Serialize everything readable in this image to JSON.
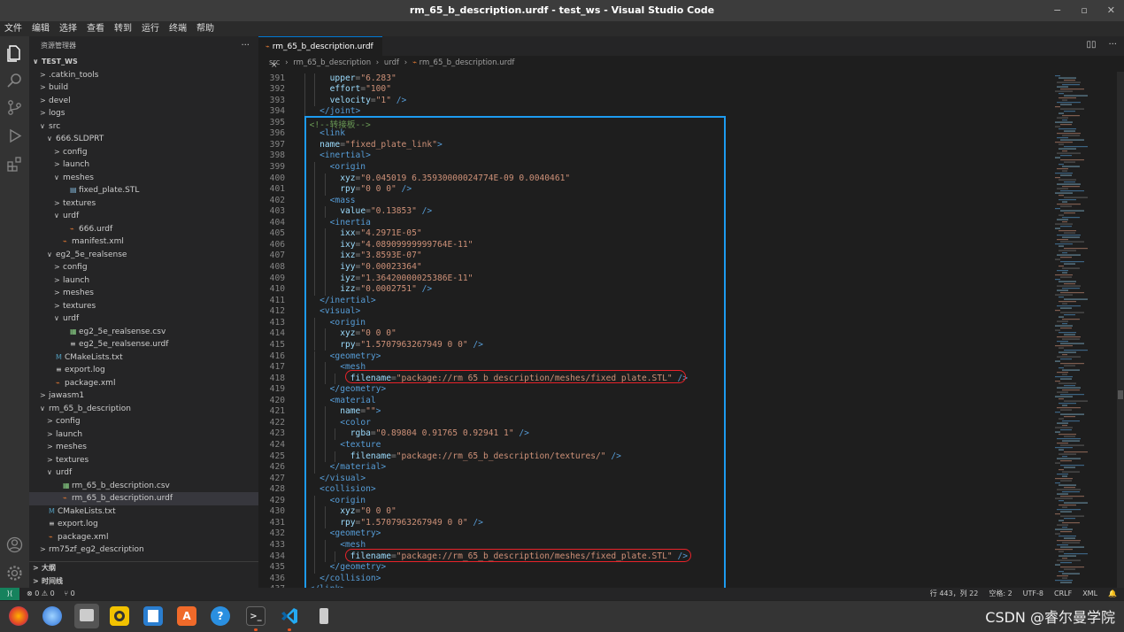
{
  "window": {
    "title": "rm_65_b_description.urdf - test_ws - Visual Studio Code"
  },
  "menu": [
    "文件",
    "编辑",
    "选择",
    "查看",
    "转到",
    "运行",
    "终端",
    "帮助"
  ],
  "sidebar": {
    "header": "资源管理器",
    "more": "···",
    "rows": [
      {
        "label": "TEST_WS",
        "depth": 0,
        "chev": "∨",
        "icon": "",
        "bold": true
      },
      {
        "label": ".catkin_tools",
        "depth": 1,
        "chev": ">",
        "icon": ""
      },
      {
        "label": "build",
        "depth": 1,
        "chev": ">",
        "icon": ""
      },
      {
        "label": "devel",
        "depth": 1,
        "chev": ">",
        "icon": ""
      },
      {
        "label": "logs",
        "depth": 1,
        "chev": ">",
        "icon": ""
      },
      {
        "label": "src",
        "depth": 1,
        "chev": "∨",
        "icon": ""
      },
      {
        "label": "666.SLDPRT",
        "depth": 2,
        "chev": "∨",
        "icon": ""
      },
      {
        "label": "config",
        "depth": 3,
        "chev": ">",
        "icon": ""
      },
      {
        "label": "launch",
        "depth": 3,
        "chev": ">",
        "icon": ""
      },
      {
        "label": "meshes",
        "depth": 3,
        "chev": "∨",
        "icon": ""
      },
      {
        "label": "fixed_plate.STL",
        "depth": 4,
        "chev": "",
        "icon": "stl"
      },
      {
        "label": "textures",
        "depth": 3,
        "chev": ">",
        "icon": ""
      },
      {
        "label": "urdf",
        "depth": 3,
        "chev": "∨",
        "icon": ""
      },
      {
        "label": "666.urdf",
        "depth": 4,
        "chev": "",
        "icon": "rss"
      },
      {
        "label": "manifest.xml",
        "depth": 3,
        "chev": "",
        "icon": "rss"
      },
      {
        "label": "eg2_5e_realsense",
        "depth": 2,
        "chev": "∨",
        "icon": ""
      },
      {
        "label": "config",
        "depth": 3,
        "chev": ">",
        "icon": ""
      },
      {
        "label": "launch",
        "depth": 3,
        "chev": ">",
        "icon": ""
      },
      {
        "label": "meshes",
        "depth": 3,
        "chev": ">",
        "icon": ""
      },
      {
        "label": "textures",
        "depth": 3,
        "chev": ">",
        "icon": ""
      },
      {
        "label": "urdf",
        "depth": 3,
        "chev": "∨",
        "icon": ""
      },
      {
        "label": "eg2_5e_realsense.csv",
        "depth": 4,
        "chev": "",
        "icon": "csv"
      },
      {
        "label": "eg2_5e_realsense.urdf",
        "depth": 4,
        "chev": "",
        "icon": "eq"
      },
      {
        "label": "CMakeLists.txt",
        "depth": 2,
        "chev": "",
        "icon": "m"
      },
      {
        "label": "export.log",
        "depth": 2,
        "chev": "",
        "icon": "log"
      },
      {
        "label": "package.xml",
        "depth": 2,
        "chev": "",
        "icon": "rss"
      },
      {
        "label": "jawasm1",
        "depth": 1,
        "chev": ">",
        "icon": ""
      },
      {
        "label": "rm_65_b_description",
        "depth": 1,
        "chev": "∨",
        "icon": ""
      },
      {
        "label": "config",
        "depth": 2,
        "chev": ">",
        "icon": ""
      },
      {
        "label": "launch",
        "depth": 2,
        "chev": ">",
        "icon": ""
      },
      {
        "label": "meshes",
        "depth": 2,
        "chev": ">",
        "icon": ""
      },
      {
        "label": "textures",
        "depth": 2,
        "chev": ">",
        "icon": ""
      },
      {
        "label": "urdf",
        "depth": 2,
        "chev": "∨",
        "icon": ""
      },
      {
        "label": "rm_65_b_description.csv",
        "depth": 3,
        "chev": "",
        "icon": "csv"
      },
      {
        "label": "rm_65_b_description.urdf",
        "depth": 3,
        "chev": "",
        "icon": "rss",
        "selected": true
      },
      {
        "label": "CMakeLists.txt",
        "depth": 1,
        "chev": "",
        "icon": "m"
      },
      {
        "label": "export.log",
        "depth": 1,
        "chev": "",
        "icon": "log"
      },
      {
        "label": "package.xml",
        "depth": 1,
        "chev": "",
        "icon": "rss"
      },
      {
        "label": "rm75zf_eg2_description",
        "depth": 1,
        "chev": ">",
        "icon": ""
      }
    ],
    "outline": "大纲",
    "timeline": "时间线"
  },
  "editor": {
    "tab": "rm_65_b_description.urdf",
    "tab_close": "×",
    "breadcrumb": [
      "src",
      "rm_65_b_description",
      "urdf",
      "rm_65_b_description.urdf"
    ],
    "lines": [
      {
        "n": "391",
        "i": 6,
        "t": [
          [
            "at",
            "upper"
          ],
          [
            "pn",
            "="
          ],
          [
            "st",
            "\"6.283\""
          ]
        ]
      },
      {
        "n": "392",
        "i": 6,
        "t": [
          [
            "at",
            "effort"
          ],
          [
            "pn",
            "="
          ],
          [
            "st",
            "\"100\""
          ]
        ]
      },
      {
        "n": "393",
        "i": 6,
        "t": [
          [
            "at",
            "velocity"
          ],
          [
            "pn",
            "="
          ],
          [
            "st",
            "\"1\""
          ],
          [
            "tg",
            " />"
          ]
        ]
      },
      {
        "n": "394",
        "i": 4,
        "t": [
          [
            "tg",
            "</joint>"
          ]
        ]
      },
      {
        "n": "395",
        "i": 2,
        "t": [
          [
            "cm",
            "<!--转接板-->"
          ]
        ]
      },
      {
        "n": "396",
        "i": 4,
        "t": [
          [
            "tg",
            "<link"
          ]
        ]
      },
      {
        "n": "397",
        "i": 4,
        "t": [
          [
            "at",
            "name"
          ],
          [
            "pn",
            "="
          ],
          [
            "st",
            "\"fixed_plate_link\""
          ],
          [
            "tg",
            ">"
          ]
        ]
      },
      {
        "n": "398",
        "i": 4,
        "t": [
          [
            "tg",
            "<inertial>"
          ]
        ]
      },
      {
        "n": "399",
        "i": 6,
        "t": [
          [
            "tg",
            "<origin"
          ]
        ]
      },
      {
        "n": "400",
        "i": 8,
        "t": [
          [
            "at",
            "xyz"
          ],
          [
            "pn",
            "="
          ],
          [
            "st",
            "\"0.045019 6.35930000024774E-09 0.0040461\""
          ]
        ]
      },
      {
        "n": "401",
        "i": 8,
        "t": [
          [
            "at",
            "rpy"
          ],
          [
            "pn",
            "="
          ],
          [
            "st",
            "\"0 0 0\""
          ],
          [
            "tg",
            " />"
          ]
        ]
      },
      {
        "n": "402",
        "i": 6,
        "t": [
          [
            "tg",
            "<mass"
          ]
        ]
      },
      {
        "n": "403",
        "i": 8,
        "t": [
          [
            "at",
            "value"
          ],
          [
            "pn",
            "="
          ],
          [
            "st",
            "\"0.13853\""
          ],
          [
            "tg",
            " />"
          ]
        ]
      },
      {
        "n": "404",
        "i": 6,
        "t": [
          [
            "tg",
            "<inertia"
          ]
        ]
      },
      {
        "n": "405",
        "i": 8,
        "t": [
          [
            "at",
            "ixx"
          ],
          [
            "pn",
            "="
          ],
          [
            "st",
            "\"4.2971E-05\""
          ]
        ]
      },
      {
        "n": "406",
        "i": 8,
        "t": [
          [
            "at",
            "ixy"
          ],
          [
            "pn",
            "="
          ],
          [
            "st",
            "\"4.08909999999764E-11\""
          ]
        ]
      },
      {
        "n": "407",
        "i": 8,
        "t": [
          [
            "at",
            "ixz"
          ],
          [
            "pn",
            "="
          ],
          [
            "st",
            "\"3.8593E-07\""
          ]
        ]
      },
      {
        "n": "408",
        "i": 8,
        "t": [
          [
            "at",
            "iyy"
          ],
          [
            "pn",
            "="
          ],
          [
            "st",
            "\"0.00023364\""
          ]
        ]
      },
      {
        "n": "409",
        "i": 8,
        "t": [
          [
            "at",
            "iyz"
          ],
          [
            "pn",
            "="
          ],
          [
            "st",
            "\"1.36420000025386E-11\""
          ]
        ]
      },
      {
        "n": "410",
        "i": 8,
        "t": [
          [
            "at",
            "izz"
          ],
          [
            "pn",
            "="
          ],
          [
            "st",
            "\"0.0002751\""
          ],
          [
            "tg",
            " />"
          ]
        ]
      },
      {
        "n": "411",
        "i": 4,
        "t": [
          [
            "tg",
            "</inertial>"
          ]
        ]
      },
      {
        "n": "412",
        "i": 4,
        "t": [
          [
            "tg",
            "<visual>"
          ]
        ]
      },
      {
        "n": "413",
        "i": 6,
        "t": [
          [
            "tg",
            "<origin"
          ]
        ]
      },
      {
        "n": "414",
        "i": 8,
        "t": [
          [
            "at",
            "xyz"
          ],
          [
            "pn",
            "="
          ],
          [
            "st",
            "\"0 0 0\""
          ]
        ]
      },
      {
        "n": "415",
        "i": 8,
        "t": [
          [
            "at",
            "rpy"
          ],
          [
            "pn",
            "="
          ],
          [
            "st",
            "\"1.5707963267949 0 0\""
          ],
          [
            "tg",
            " />"
          ]
        ]
      },
      {
        "n": "416",
        "i": 6,
        "t": [
          [
            "tg",
            "<geometry>"
          ]
        ]
      },
      {
        "n": "417",
        "i": 8,
        "t": [
          [
            "tg",
            "<mesh"
          ]
        ]
      },
      {
        "n": "418",
        "i": 10,
        "t": [
          [
            "at",
            "filename"
          ],
          [
            "pn",
            "="
          ],
          [
            "st",
            "\"package://rm_65_b_description/meshes/fixed_plate.STL\""
          ],
          [
            "tg",
            " />"
          ]
        ]
      },
      {
        "n": "419",
        "i": 6,
        "t": [
          [
            "tg",
            "</geometry>"
          ]
        ]
      },
      {
        "n": "420",
        "i": 6,
        "t": [
          [
            "tg",
            "<material"
          ]
        ]
      },
      {
        "n": "421",
        "i": 8,
        "t": [
          [
            "at",
            "name"
          ],
          [
            "pn",
            "="
          ],
          [
            "st",
            "\"\""
          ],
          [
            "tg",
            ">"
          ]
        ]
      },
      {
        "n": "422",
        "i": 8,
        "t": [
          [
            "tg",
            "<color"
          ]
        ]
      },
      {
        "n": "423",
        "i": 10,
        "t": [
          [
            "at",
            "rgba"
          ],
          [
            "pn",
            "="
          ],
          [
            "st",
            "\"0.89804 0.91765 0.92941 1\""
          ],
          [
            "tg",
            " />"
          ]
        ]
      },
      {
        "n": "424",
        "i": 8,
        "t": [
          [
            "tg",
            "<texture"
          ]
        ]
      },
      {
        "n": "425",
        "i": 10,
        "t": [
          [
            "at",
            "filename"
          ],
          [
            "pn",
            "="
          ],
          [
            "st",
            "\"package://rm_65_b_description/textures/\""
          ],
          [
            "tg",
            " />"
          ]
        ]
      },
      {
        "n": "426",
        "i": 6,
        "t": [
          [
            "tg",
            "</material>"
          ]
        ]
      },
      {
        "n": "427",
        "i": 4,
        "t": [
          [
            "tg",
            "</visual>"
          ]
        ]
      },
      {
        "n": "428",
        "i": 4,
        "t": [
          [
            "tg",
            "<collision>"
          ]
        ]
      },
      {
        "n": "429",
        "i": 6,
        "t": [
          [
            "tg",
            "<origin"
          ]
        ]
      },
      {
        "n": "430",
        "i": 8,
        "t": [
          [
            "at",
            "xyz"
          ],
          [
            "pn",
            "="
          ],
          [
            "st",
            "\"0 0 0\""
          ]
        ]
      },
      {
        "n": "431",
        "i": 8,
        "t": [
          [
            "at",
            "rpy"
          ],
          [
            "pn",
            "="
          ],
          [
            "st",
            "\"1.5707963267949 0 0\""
          ],
          [
            "tg",
            " />"
          ]
        ]
      },
      {
        "n": "432",
        "i": 6,
        "t": [
          [
            "tg",
            "<geometry>"
          ]
        ]
      },
      {
        "n": "433",
        "i": 8,
        "t": [
          [
            "tg",
            "<mesh"
          ]
        ]
      },
      {
        "n": "434",
        "i": 10,
        "t": [
          [
            "at",
            "filename"
          ],
          [
            "pn",
            "="
          ],
          [
            "st",
            "\"package://rm_65_b_description/meshes/fixed_plate.STL\""
          ],
          [
            "tg",
            " />"
          ]
        ]
      },
      {
        "n": "435",
        "i": 6,
        "t": [
          [
            "tg",
            "</geometry>"
          ]
        ]
      },
      {
        "n": "436",
        "i": 4,
        "t": [
          [
            "tg",
            "</collision>"
          ]
        ]
      },
      {
        "n": "437",
        "i": 2,
        "t": [
          [
            "tg",
            "</link>"
          ]
        ]
      }
    ]
  },
  "statusbar": {
    "remote": "⟩⟨",
    "problems": "⊗ 0 ⚠ 0",
    "ports": "⑂ 0",
    "position": "行 443，列 22",
    "spaces": "空格: 2",
    "encoding": "UTF-8",
    "eol": "CRLF",
    "language": "XML",
    "bell": "🔔"
  },
  "watermark": "CSDN @睿尔曼学院",
  "colors": {
    "accent": "#0078d4",
    "highlight_box": "#1d9bf0",
    "red_oval": "#e8232a"
  }
}
